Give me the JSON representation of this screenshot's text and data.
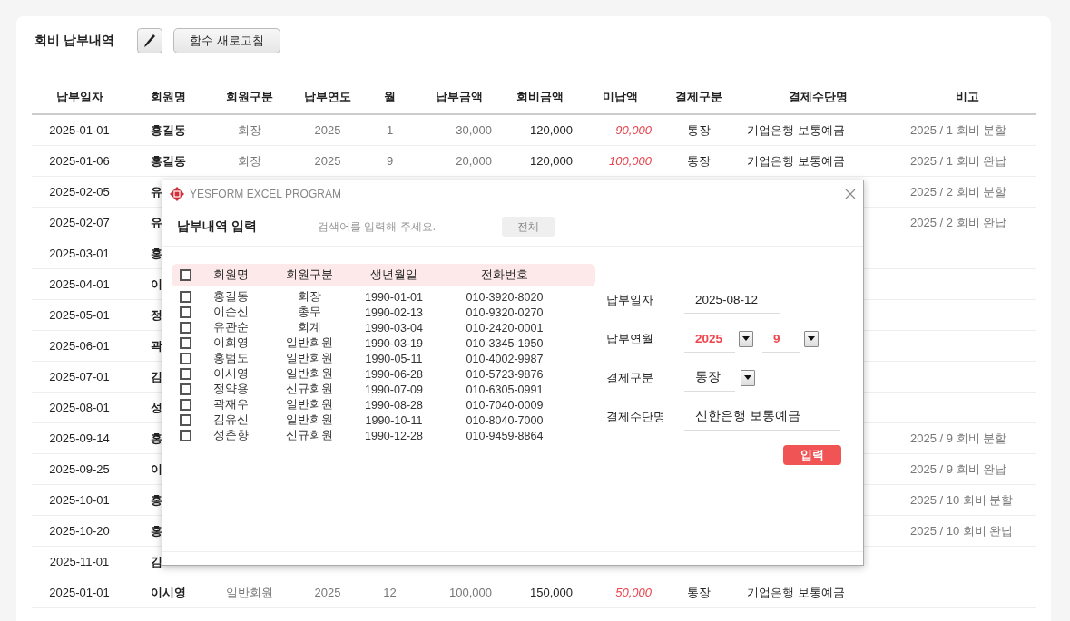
{
  "page": {
    "title": "회비 납부내역",
    "refresh_button": "함수 새로고침"
  },
  "table": {
    "columns": [
      "납부일자",
      "회원명",
      "회원구분",
      "납부연도",
      "월",
      "납부금액",
      "회비금액",
      "미납액",
      "결제구분",
      "결제수단명",
      "비고"
    ],
    "rows": [
      {
        "date": "2025-01-01",
        "name": "홍길동",
        "member_type": "회장",
        "year": "2025",
        "month": "1",
        "paid": "30,000",
        "fee": "120,000",
        "unpaid": "90,000",
        "pay_type": "통장",
        "pay_method": "기업은행 보통예금",
        "note": "2025 / 1 회비 분할"
      },
      {
        "date": "2025-01-06",
        "name": "홍길동",
        "member_type": "회장",
        "year": "2025",
        "month": "9",
        "paid": "20,000",
        "fee": "120,000",
        "unpaid": "100,000",
        "pay_type": "통장",
        "pay_method": "기업은행 보통예금",
        "note": "2025 / 1 회비 완납"
      },
      {
        "date": "2025-02-05",
        "name": "유",
        "note": "2025 / 2 회비 분할"
      },
      {
        "date": "2025-02-07",
        "name": "유",
        "note": "2025 / 2 회비 완납"
      },
      {
        "date": "2025-03-01",
        "name": "홍"
      },
      {
        "date": "2025-04-01",
        "name": "이"
      },
      {
        "date": "2025-05-01",
        "name": "정"
      },
      {
        "date": "2025-06-01",
        "name": "곽"
      },
      {
        "date": "2025-07-01",
        "name": "김"
      },
      {
        "date": "2025-08-01",
        "name": "성"
      },
      {
        "date": "2025-09-14",
        "name": "홍",
        "note": "2025 / 9 회비 분할"
      },
      {
        "date": "2025-09-25",
        "name": "이",
        "note": "2025 / 9 회비 완납"
      },
      {
        "date": "2025-10-01",
        "name": "홍",
        "note": "2025 / 10 회비 분할"
      },
      {
        "date": "2025-10-20",
        "name": "홍",
        "note": "2025 / 10 회비 완납"
      },
      {
        "date": "2025-11-01",
        "name": "김"
      },
      {
        "date": "2025-01-01",
        "name": "이시영",
        "member_type": "일반회원",
        "year": "2025",
        "month": "12",
        "paid": "100,000",
        "fee": "150,000",
        "unpaid": "50,000",
        "pay_type": "통장",
        "pay_method": "기업은행 보통예금"
      }
    ]
  },
  "dialog": {
    "title": "YESFORM EXCEL PROGRAM",
    "heading": "납부내역 입력",
    "search": {
      "placeholder": "검색어를 입력해 주세요."
    },
    "all_button": "전체",
    "member_list": {
      "all_checked": false,
      "columns": [
        "회원명",
        "회원구분",
        "생년월일",
        "전화번호"
      ],
      "rows": [
        {
          "name": "홍길동",
          "type": "회장",
          "birth": "1990-01-01",
          "phone": "010-3920-8020",
          "checked": false
        },
        {
          "name": "이순신",
          "type": "총무",
          "birth": "1990-02-13",
          "phone": "010-9320-0270",
          "checked": false
        },
        {
          "name": "유관순",
          "type": "회계",
          "birth": "1990-03-04",
          "phone": "010-2420-0001",
          "checked": false
        },
        {
          "name": "이회영",
          "type": "일반회원",
          "birth": "1990-03-19",
          "phone": "010-3345-1950",
          "checked": false
        },
        {
          "name": "홍범도",
          "type": "일반회원",
          "birth": "1990-05-11",
          "phone": "010-4002-9987",
          "checked": false
        },
        {
          "name": "이시영",
          "type": "일반회원",
          "birth": "1990-06-28",
          "phone": "010-5723-9876",
          "checked": false
        },
        {
          "name": "정약용",
          "type": "신규회원",
          "birth": "1990-07-09",
          "phone": "010-6305-0991",
          "checked": false
        },
        {
          "name": "곽재우",
          "type": "일반회원",
          "birth": "1990-08-28",
          "phone": "010-7040-0009",
          "checked": false
        },
        {
          "name": "김유신",
          "type": "일반회원",
          "birth": "1990-10-11",
          "phone": "010-8040-7000",
          "checked": false
        },
        {
          "name": "성춘향",
          "type": "신규회원",
          "birth": "1990-12-28",
          "phone": "010-9459-8864",
          "checked": false
        }
      ]
    },
    "form": [
      {
        "label": "납부일자",
        "kind": "text",
        "value": "2025-08-12"
      },
      {
        "label": "납부연월",
        "kind": "year_month",
        "values": [
          "2025",
          "9"
        ]
      },
      {
        "label": "결제구분",
        "kind": "select",
        "values": [
          "통장"
        ]
      },
      {
        "label": "결제수단명",
        "kind": "wide_text",
        "value": "신한은행 보통예금"
      }
    ],
    "submit_button": "입력"
  }
}
